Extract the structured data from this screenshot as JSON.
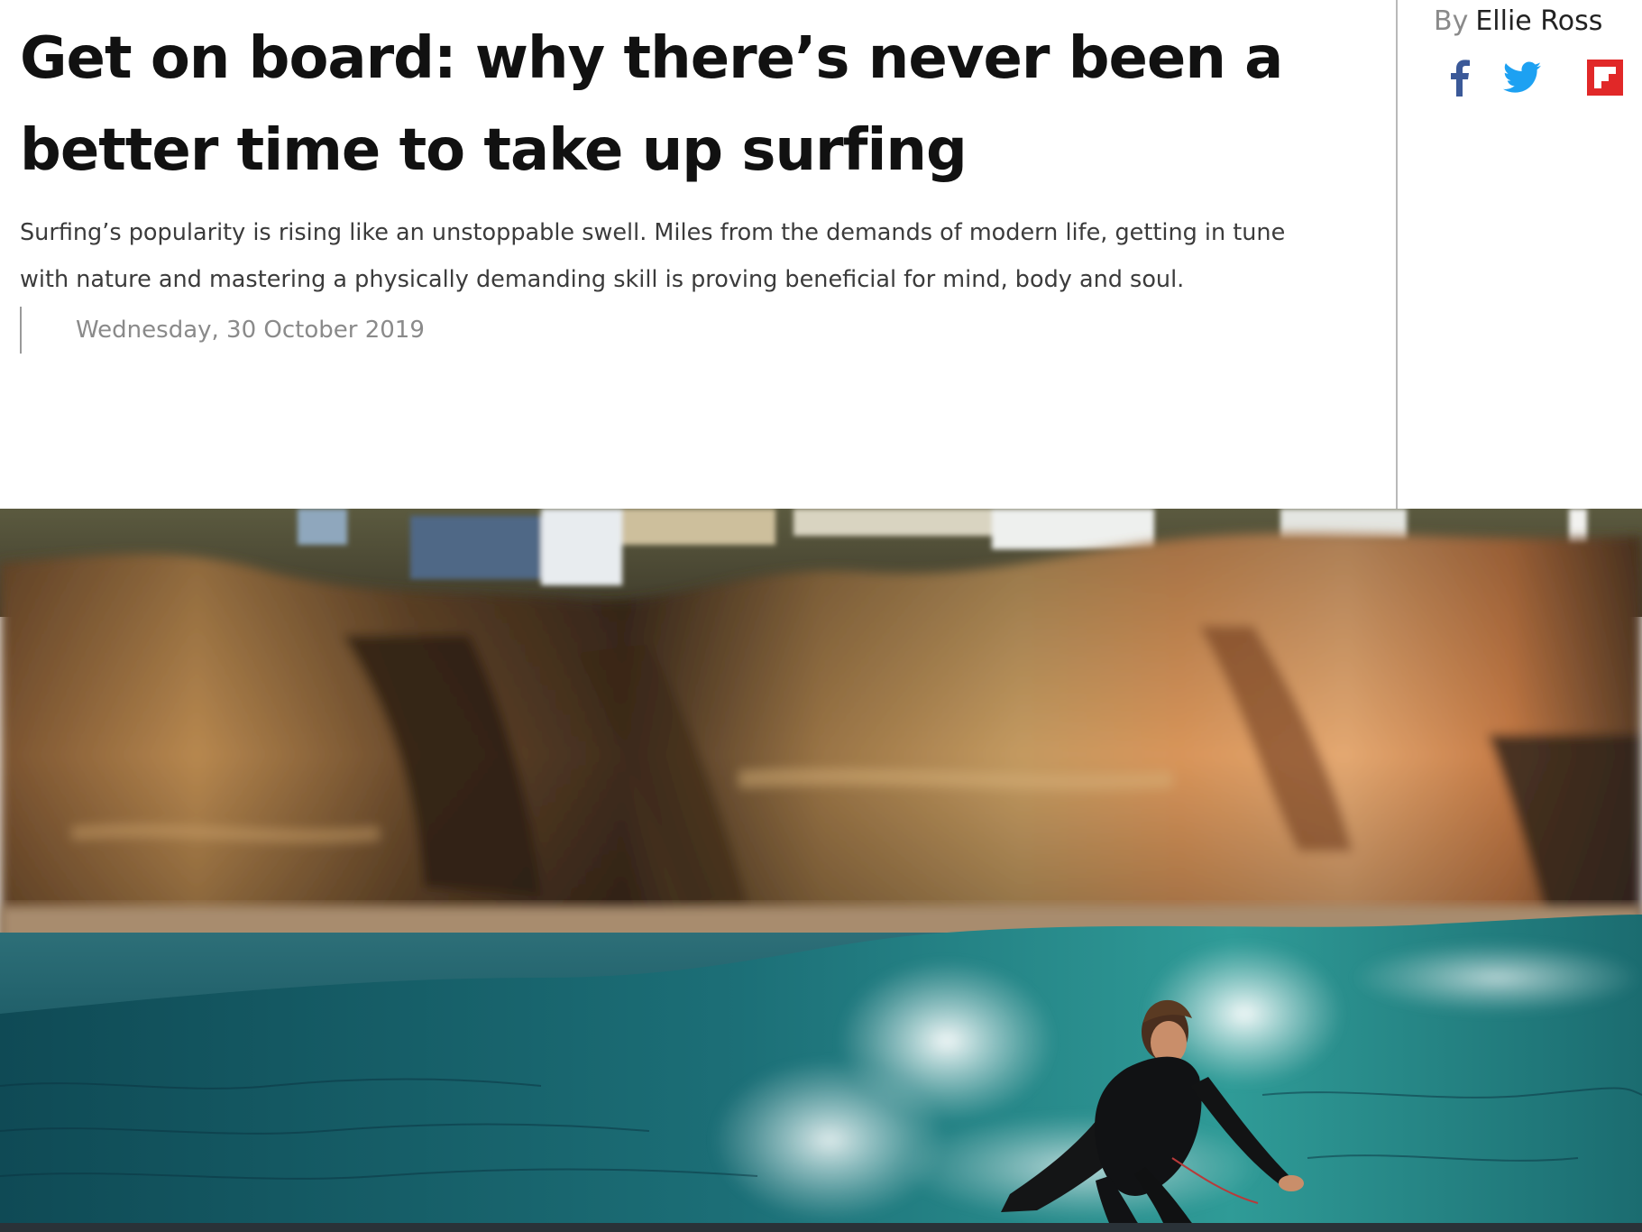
{
  "article": {
    "headline": "Get on board: why there’s never been a better time to take up surfing",
    "standfirst": "Surfing’s popularity is rising like an unstoppable swell. Miles from the demands of modern life, getting in tune with nature and mastering a physically demanding skill is proving beneficial for mind, body and soul.",
    "date": "Wednesday, 30 October 2019"
  },
  "byline": {
    "prefix": "By",
    "author": "Ellie Ross"
  },
  "share": {
    "icons": [
      "facebook-icon",
      "twitter-icon",
      "flipboard-icon"
    ],
    "colors": {
      "facebook": "#3b5998",
      "twitter": "#1da1f2",
      "flipboard": "#e12828"
    }
  },
  "hero_image": {
    "subject": "surfer riding a wave below sandstone cliffs"
  }
}
